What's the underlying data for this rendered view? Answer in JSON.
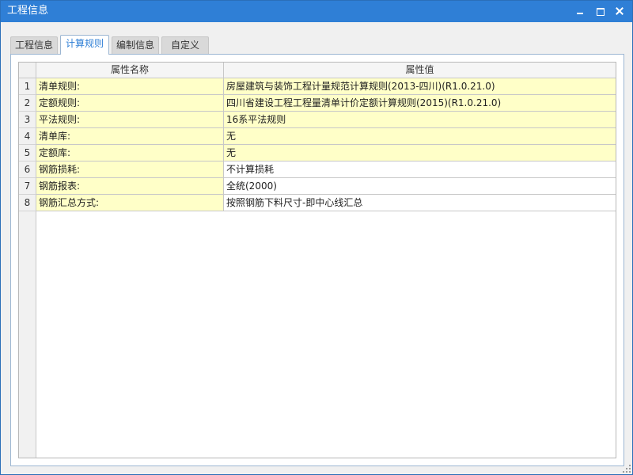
{
  "window": {
    "title": "工程信息"
  },
  "tabs": [
    {
      "label": "工程信息",
      "active": false
    },
    {
      "label": "计算规则",
      "active": true
    },
    {
      "label": "编制信息",
      "active": false
    },
    {
      "label": "自定义",
      "active": false
    }
  ],
  "grid": {
    "columns": {
      "name": "属性名称",
      "value": "属性值"
    },
    "rows": [
      {
        "num": "1",
        "name": "清单规则:",
        "value": "房屋建筑与装饰工程计量规范计算规则(2013-四川)(R1.0.21.0)",
        "highlighted": true
      },
      {
        "num": "2",
        "name": "定额规则:",
        "value": "四川省建设工程工程量清单计价定额计算规则(2015)(R1.0.21.0)",
        "highlighted": true
      },
      {
        "num": "3",
        "name": "平法规则:",
        "value": "16系平法规则",
        "highlighted": true
      },
      {
        "num": "4",
        "name": "清单库:",
        "value": "无",
        "highlighted": true
      },
      {
        "num": "5",
        "name": "定额库:",
        "value": "无",
        "highlighted": true
      },
      {
        "num": "6",
        "name": "钢筋损耗:",
        "value": "不计算损耗",
        "highlighted": false
      },
      {
        "num": "7",
        "name": "钢筋报表:",
        "value": "全统(2000)",
        "highlighted": false
      },
      {
        "num": "8",
        "name": "钢筋汇总方式:",
        "value": "按照钢筋下料尺寸-即中心线汇总",
        "highlighted": false
      }
    ]
  },
  "colors": {
    "titlebar": "#2f7fd6",
    "highlight_cell": "#ffffc8",
    "active_tab_text": "#2f7fd6"
  }
}
